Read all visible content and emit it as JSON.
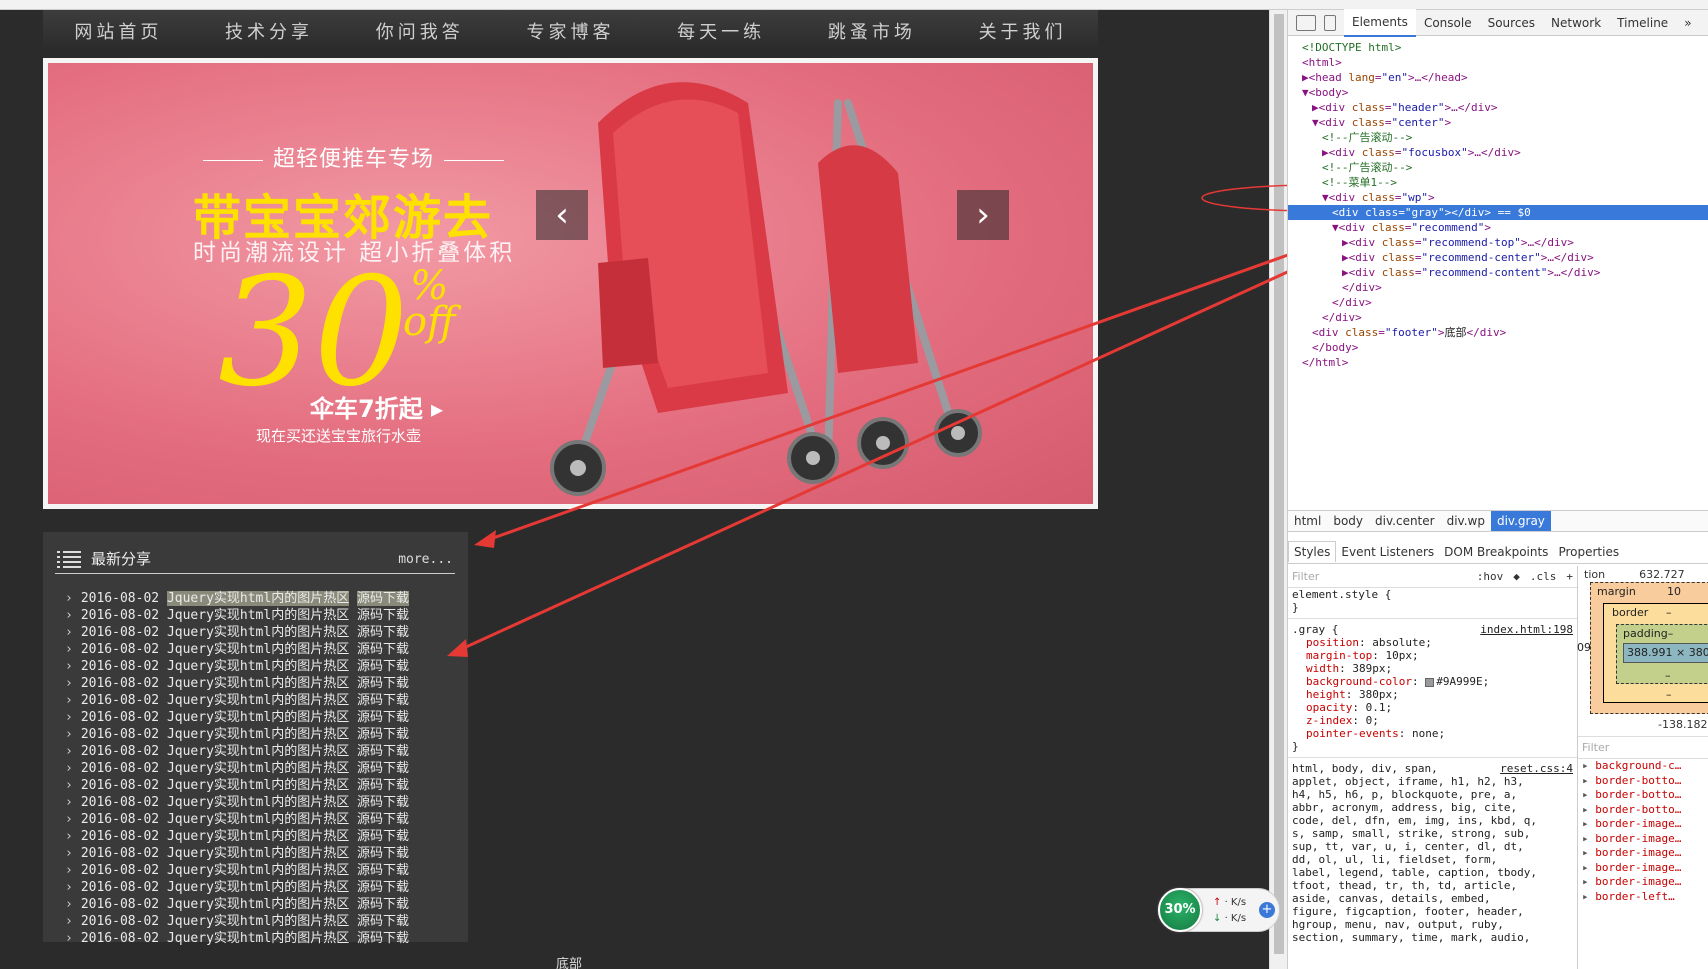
{
  "nav": [
    "网站首页",
    "技术分享",
    "你问我答",
    "专家博客",
    "每天一练",
    "跳蚤市场",
    "关于我们"
  ],
  "banner": {
    "subtitle": "超轻便推车专场",
    "headline": "带宝宝郊游去",
    "tagline": "时尚潮流设计   超小折叠体积",
    "big_number": "30",
    "percent_sign": "%",
    "off": "off",
    "deal": "伞车7折起 ▸",
    "note": "现在买还送宝宝旅行水壶",
    "prev_icon": "‹",
    "next_icon": "›"
  },
  "share": {
    "title": "最新分享",
    "more": "more...",
    "items": [
      {
        "date": "2016-08-02",
        "title": "Jquery实现html内的图片热区",
        "dl": "源码下载"
      },
      {
        "date": "2016-08-02",
        "title": "Jquery实现html内的图片热区",
        "dl": "源码下载"
      },
      {
        "date": "2016-08-02",
        "title": "Jquery实现html内的图片热区",
        "dl": "源码下载"
      },
      {
        "date": "2016-08-02",
        "title": "Jquery实现html内的图片热区",
        "dl": "源码下载"
      },
      {
        "date": "2016-08-02",
        "title": "Jquery实现html内的图片热区",
        "dl": "源码下载"
      },
      {
        "date": "2016-08-02",
        "title": "Jquery实现html内的图片热区",
        "dl": "源码下载"
      },
      {
        "date": "2016-08-02",
        "title": "Jquery实现html内的图片热区",
        "dl": "源码下载"
      },
      {
        "date": "2016-08-02",
        "title": "Jquery实现html内的图片热区",
        "dl": "源码下载"
      },
      {
        "date": "2016-08-02",
        "title": "Jquery实现html内的图片热区",
        "dl": "源码下载"
      },
      {
        "date": "2016-08-02",
        "title": "Jquery实现html内的图片热区",
        "dl": "源码下载"
      },
      {
        "date": "2016-08-02",
        "title": "Jquery实现html内的图片热区",
        "dl": "源码下载"
      },
      {
        "date": "2016-08-02",
        "title": "Jquery实现html内的图片热区",
        "dl": "源码下载"
      },
      {
        "date": "2016-08-02",
        "title": "Jquery实现html内的图片热区",
        "dl": "源码下载"
      },
      {
        "date": "2016-08-02",
        "title": "Jquery实现html内的图片热区",
        "dl": "源码下载"
      },
      {
        "date": "2016-08-02",
        "title": "Jquery实现html内的图片热区",
        "dl": "源码下载"
      },
      {
        "date": "2016-08-02",
        "title": "Jquery实现html内的图片热区",
        "dl": "源码下载"
      },
      {
        "date": "2016-08-02",
        "title": "Jquery实现html内的图片热区",
        "dl": "源码下载"
      },
      {
        "date": "2016-08-02",
        "title": "Jquery实现html内的图片热区",
        "dl": "源码下载"
      },
      {
        "date": "2016-08-02",
        "title": "Jquery实现html内的图片热区",
        "dl": "源码下载"
      },
      {
        "date": "2016-08-02",
        "title": "Jquery实现html内的图片热区",
        "dl": "源码下载"
      },
      {
        "date": "2016-08-02",
        "title": "Jquery实现html内的图片热区",
        "dl": "源码下载"
      }
    ]
  },
  "footer": "底部",
  "devtools": {
    "tabs": [
      "Elements",
      "Console",
      "Sources",
      "Network",
      "Timeline",
      "»"
    ],
    "active_tab": "Elements",
    "dom_lines": [
      {
        "indent": 0,
        "parts": [
          [
            "cm",
            "<!DOCTYPE html>"
          ]
        ]
      },
      {
        "indent": 0,
        "parts": [
          [
            "tg",
            "<html>"
          ]
        ]
      },
      {
        "indent": 0,
        "parts": [
          [
            "tg",
            "▶<head "
          ],
          [
            "at",
            "lang"
          ],
          [
            "tg",
            "="
          ],
          [
            "av",
            "\"en\""
          ],
          [
            "tg",
            ">…</head>"
          ]
        ]
      },
      {
        "indent": 0,
        "parts": [
          [
            "tg",
            "▼<body>"
          ]
        ]
      },
      {
        "indent": 1,
        "parts": [
          [
            "tg",
            "▶<div "
          ],
          [
            "at",
            "class"
          ],
          [
            "tg",
            "="
          ],
          [
            "av",
            "\"header\""
          ],
          [
            "tg",
            ">…</div>"
          ]
        ]
      },
      {
        "indent": 1,
        "parts": [
          [
            "tg",
            "▼<div "
          ],
          [
            "at",
            "class"
          ],
          [
            "tg",
            "="
          ],
          [
            "av",
            "\"center\""
          ],
          [
            "tg",
            ">"
          ]
        ]
      },
      {
        "indent": 2,
        "parts": [
          [
            "cm",
            "<!--广告滚动-->"
          ]
        ]
      },
      {
        "indent": 2,
        "parts": [
          [
            "tg",
            "▶<div "
          ],
          [
            "at",
            "class"
          ],
          [
            "tg",
            "="
          ],
          [
            "av",
            "\"focusbox\""
          ],
          [
            "tg",
            ">…</div>"
          ]
        ]
      },
      {
        "indent": 2,
        "parts": [
          [
            "cm",
            "<!--广告滚动-->"
          ]
        ]
      },
      {
        "indent": 2,
        "parts": [
          [
            "cm",
            "<!--菜单1-->"
          ]
        ]
      },
      {
        "indent": 2,
        "parts": [
          [
            "tg",
            "▼<div "
          ],
          [
            "at",
            "class"
          ],
          [
            "tg",
            "="
          ],
          [
            "av",
            "\"wp\""
          ],
          [
            "tg",
            ">"
          ]
        ]
      },
      {
        "indent": 3,
        "sel": true,
        "parts": [
          [
            "tg",
            "<div "
          ],
          [
            "at",
            "class"
          ],
          [
            "tg",
            "="
          ],
          [
            "av",
            "\"gray\""
          ],
          [
            "tg",
            "></div> == $0"
          ]
        ]
      },
      {
        "indent": 3,
        "parts": [
          [
            "tg",
            "▼<div "
          ],
          [
            "at",
            "class"
          ],
          [
            "tg",
            "="
          ],
          [
            "av",
            "\"recommend\""
          ],
          [
            "tg",
            ">"
          ]
        ]
      },
      {
        "indent": 4,
        "parts": [
          [
            "tg",
            "▶<div "
          ],
          [
            "at",
            "class"
          ],
          [
            "tg",
            "="
          ],
          [
            "av",
            "\"recommend-top\""
          ],
          [
            "tg",
            ">…</div>"
          ]
        ]
      },
      {
        "indent": 4,
        "parts": [
          [
            "tg",
            "▶<div "
          ],
          [
            "at",
            "class"
          ],
          [
            "tg",
            "="
          ],
          [
            "av",
            "\"recommend-center\""
          ],
          [
            "tg",
            ">…</div>"
          ]
        ]
      },
      {
        "indent": 4,
        "parts": [
          [
            "tg",
            "▶<div "
          ],
          [
            "at",
            "class"
          ],
          [
            "tg",
            "="
          ],
          [
            "av",
            "\"recommend-content\""
          ],
          [
            "tg",
            ">…</div>"
          ]
        ]
      },
      {
        "indent": 4,
        "parts": [
          [
            "tg",
            "</div>"
          ]
        ]
      },
      {
        "indent": 3,
        "parts": [
          [
            "tg",
            "</div>"
          ]
        ]
      },
      {
        "indent": 2,
        "parts": [
          [
            "tg",
            "</div>"
          ]
        ]
      },
      {
        "indent": 1,
        "parts": [
          [
            "tg",
            "<div "
          ],
          [
            "at",
            "class"
          ],
          [
            "tg",
            "="
          ],
          [
            "av",
            "\"footer\""
          ],
          [
            "tg",
            ">"
          ],
          [
            "tx",
            "底部"
          ],
          [
            "tg",
            "</div>"
          ]
        ]
      },
      {
        "indent": 1,
        "parts": [
          [
            "tg",
            "</body>"
          ]
        ]
      },
      {
        "indent": 0,
        "parts": [
          [
            "tg",
            "</html>"
          ]
        ]
      }
    ],
    "breadcrumbs": [
      "html",
      "body",
      "div.center",
      "div.wp",
      "div.gray"
    ],
    "style_tabs": [
      "Styles",
      "Event Listeners",
      "DOM Breakpoints",
      "Properties"
    ],
    "filter_placeholder": "Filter",
    "filter_opts": [
      ":hov",
      "◆",
      ".cls",
      "+"
    ],
    "element_style": [
      "element.style {",
      "}"
    ],
    "gray_rule": {
      "selector": ".gray {",
      "source": "index.html:198",
      "props": [
        [
          "position",
          "absolute;"
        ],
        [
          "margin-top",
          "10px;"
        ],
        [
          "width",
          "389px;"
        ],
        [
          "background-color",
          "#9A999E;"
        ],
        [
          "height",
          "380px;"
        ],
        [
          "opacity",
          "0.1;"
        ],
        [
          "z-index",
          "0;"
        ],
        [
          "pointer-events",
          "none;"
        ]
      ],
      "close": "}"
    },
    "reset_source": "reset.css:4",
    "reset_text": [
      "html, body, div, span,",
      "applet, object, iframe, h1, h2, h3,",
      "h4, h5, h6, p, blockquote, pre, a,",
      "abbr, acronym, address, big, cite,",
      "code, del, dfn, em, img, ins, kbd, q,",
      "s, samp, small, strike, strong, sub,",
      "sup, tt, var, u, i, center, dl, dt,",
      "dd, ol, ul, li, fieldset, form,",
      "label, legend, table, caption, tbody,",
      "tfoot, thead, tr, th, td, article,",
      "aside, canvas, details, embed,",
      "figure, figcaption, footer, header,",
      "hgroup, menu, nav, output, ruby,",
      "section, summary, time, mark, audio,"
    ],
    "box_model": {
      "position_label": "tion",
      "position_value": "632.727",
      "margin_label": "margin",
      "margin_value": "10",
      "border_label": "border",
      "border_value": "–",
      "padding_label": "padding–",
      "content": "388.991 × 380",
      "left_value": "09",
      "dash": "–",
      "bottom_value": "-138.182"
    },
    "computed_filter": "Filter",
    "computed_props": [
      "background-c…",
      "border-botto…",
      "border-botto…",
      "border-botto…",
      "border-image…",
      "border-image…",
      "border-image…",
      "border-image…",
      "border-image…",
      "border-left…"
    ]
  },
  "netwidget": {
    "percent": "30%",
    "up": "· K/s",
    "down": "· K/s",
    "plus": "+"
  }
}
